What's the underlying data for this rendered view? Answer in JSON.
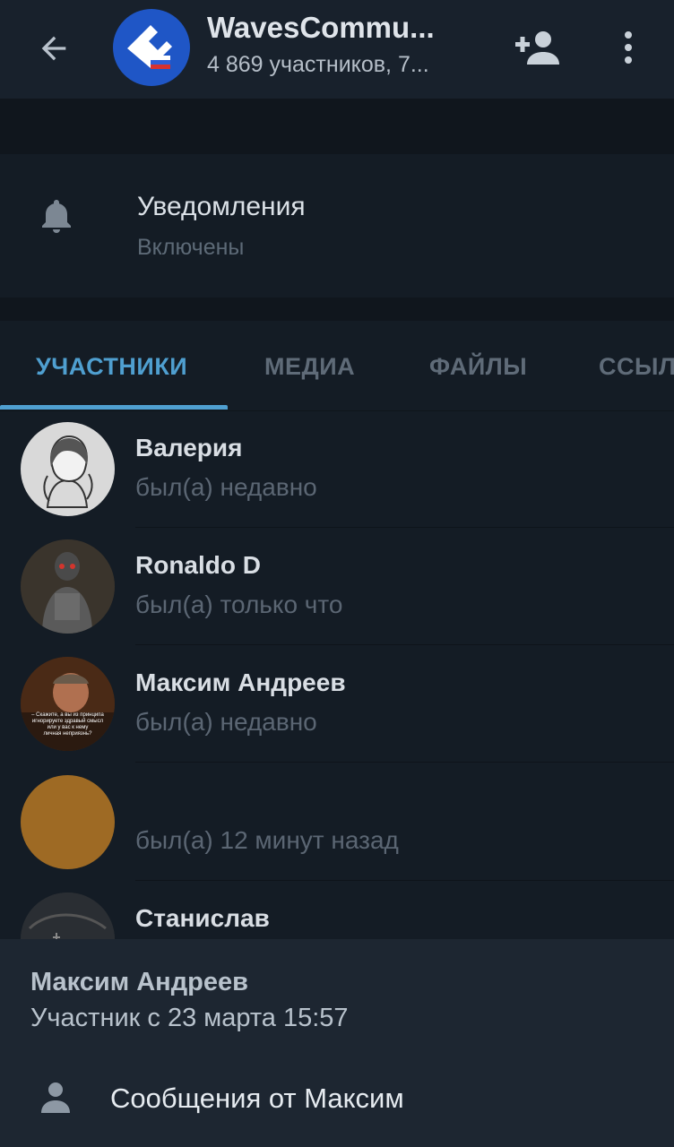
{
  "header": {
    "title": "WavesCommu...",
    "subtitle": "4 869 участников, 7...",
    "icons": {
      "back": "arrow-left-icon",
      "add": "add-person-icon",
      "more": "more-vertical-icon"
    }
  },
  "notifications": {
    "title": "Уведомления",
    "status": "Включены",
    "icon": "bell-icon"
  },
  "tabs": [
    {
      "label": "УЧАСТНИКИ",
      "active": true
    },
    {
      "label": "МЕДИА",
      "active": false
    },
    {
      "label": "ФАЙЛЫ",
      "active": false
    },
    {
      "label": "ССЫЛ",
      "active": false
    }
  ],
  "members": [
    {
      "name": "Валерия",
      "status": "был(а) недавно"
    },
    {
      "name": "Ronaldo D",
      "status": "был(а) только что"
    },
    {
      "name": "Максим Андреев",
      "status": "был(а) недавно",
      "avatar_text": [
        "– Скажите, а вы из принципа",
        "игнорируете здравый смысл",
        "или у вас к нему",
        "личная неприязнь?"
      ]
    },
    {
      "name": "",
      "status": "был(а) 12 минут назад",
      "avatar_color": "#9e6a24"
    },
    {
      "name": "Станислав",
      "status": ""
    }
  ],
  "sheet": {
    "name": "Максим Андреев",
    "since": "Участник с 23 марта 15:57",
    "action_label": "Сообщения от Максим",
    "action_icon": "person-icon"
  },
  "colors": {
    "accent": "#4f9fd0",
    "background": "#141c25",
    "sheet": "#1d2631",
    "group_avatar": "#1f56c6"
  }
}
